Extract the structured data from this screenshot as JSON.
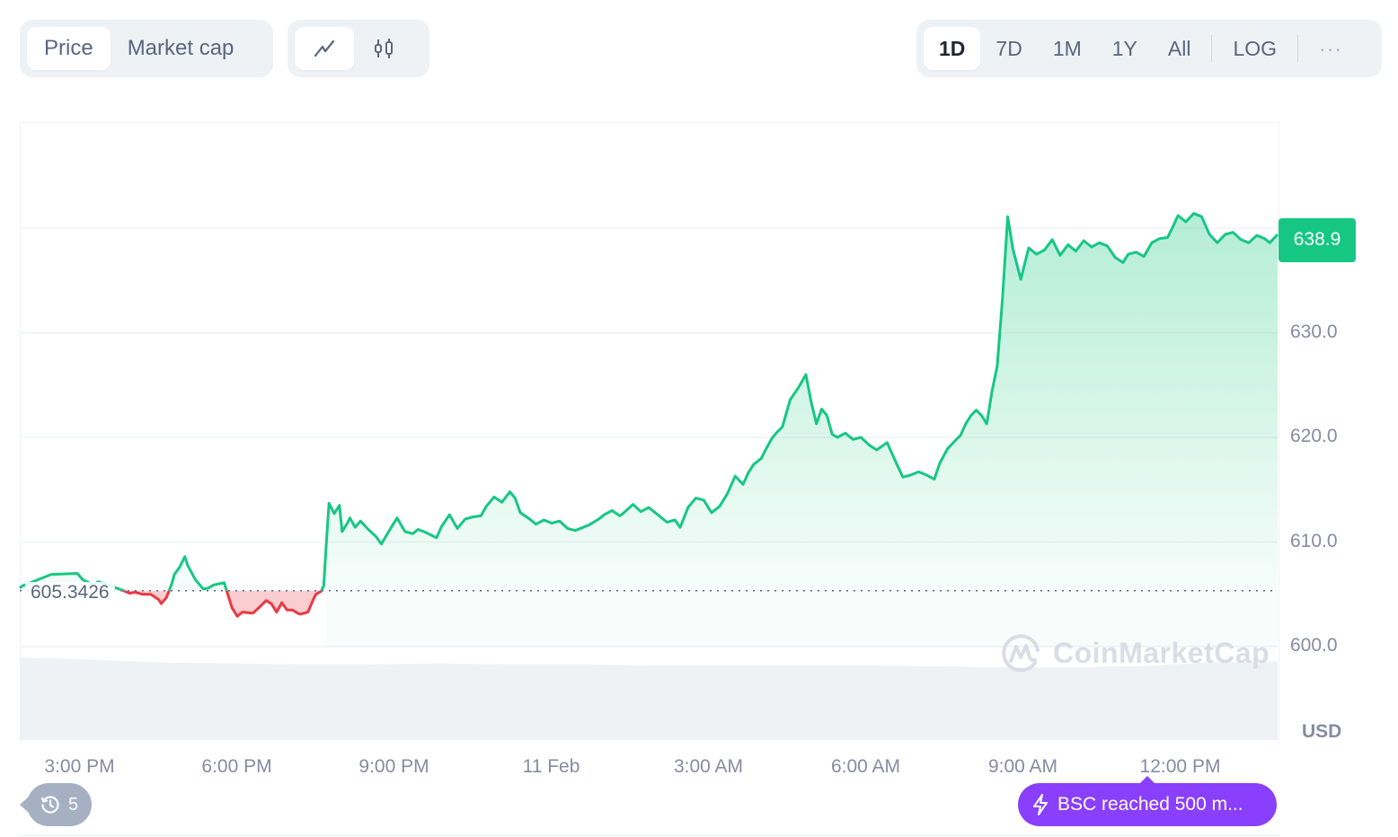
{
  "toolbar": {
    "data_type": {
      "options": [
        {
          "label": "Price",
          "active": true
        },
        {
          "label": "Market cap",
          "active": false
        }
      ]
    },
    "chart_type": {
      "options": [
        {
          "icon": "line-chart-icon",
          "active": true
        },
        {
          "icon": "candlestick-icon",
          "active": false
        }
      ]
    },
    "ranges": [
      {
        "label": "1D",
        "active": true
      },
      {
        "label": "7D",
        "active": false
      },
      {
        "label": "1M",
        "active": false
      },
      {
        "label": "1Y",
        "active": false
      },
      {
        "label": "All",
        "active": false
      }
    ],
    "log_label": "LOG",
    "more_label": "···"
  },
  "colors": {
    "up": "#16c784",
    "down": "#ea3943",
    "event": "#8a3ffc",
    "history_badge": "#a6b0c3"
  },
  "current_price_label": "638.9",
  "baseline_label": "605.3426",
  "currency_label": "USD",
  "watermark": "CoinMarketCap",
  "history_badge": {
    "icon": "history-icon",
    "count": "5"
  },
  "event_badge": {
    "icon": "lightning-icon",
    "text": "BSC reached 500 m..."
  },
  "chart_data": {
    "type": "area",
    "title": "",
    "xlabel": "",
    "ylabel": "USD",
    "baseline": 605.3426,
    "ylim": [
      596.5,
      646
    ],
    "x_tick_labels": [
      "3:00 PM",
      "6:00 PM",
      "9:00 PM",
      "11 Feb",
      "3:00 AM",
      "6:00 AM",
      "9:00 AM",
      "12:00 PM"
    ],
    "x_tick_hours": [
      1.14,
      4.14,
      7.14,
      10.14,
      13.14,
      16.14,
      19.14,
      22.14
    ],
    "y_tick_labels": [
      "600.0",
      "610.0",
      "620.0",
      "630.0"
    ],
    "y_ticks": [
      600,
      610,
      620,
      630
    ],
    "grid": true,
    "x_hours_span": 24,
    "series": [
      {
        "name": "Price",
        "x_hours": [
          0,
          0.05,
          0.6,
          1.1,
          1.2,
          1.4,
          1.5,
          1.9,
          2.1,
          2.2,
          2.35,
          2.5,
          2.65,
          2.7,
          2.8,
          2.9,
          2.95,
          3.05,
          3.15,
          3.2,
          3.35,
          3.5,
          3.6,
          3.7,
          3.8,
          3.9,
          4.05,
          4.15,
          4.25,
          4.45,
          4.6,
          4.7,
          4.8,
          4.9,
          5.0,
          5.1,
          5.2,
          5.3,
          5.35,
          5.5,
          5.6,
          5.65,
          5.75,
          5.8,
          5.85,
          5.9,
          6.0,
          6.1,
          6.15,
          6.25,
          6.3,
          6.4,
          6.5,
          6.65,
          6.8,
          6.9,
          7.05,
          7.2,
          7.35,
          7.5,
          7.6,
          7.75,
          7.95,
          8.05,
          8.2,
          8.35,
          8.5,
          8.65,
          8.8,
          8.9,
          9.05,
          9.2,
          9.35,
          9.45,
          9.55,
          9.7,
          9.85,
          10.0,
          10.15,
          10.3,
          10.45,
          10.6,
          10.75,
          10.85,
          10.95,
          11.05,
          11.15,
          11.3,
          11.45,
          11.55,
          11.7,
          11.85,
          12.0,
          12.1,
          12.2,
          12.35,
          12.5,
          12.6,
          12.75,
          12.9,
          13.05,
          13.2,
          13.35,
          13.5,
          13.65,
          13.8,
          13.9,
          14.0,
          14.15,
          14.25,
          14.35,
          14.45,
          14.55,
          14.7,
          14.85,
          15.0,
          15.1,
          15.2,
          15.3,
          15.4,
          15.5,
          15.6,
          15.75,
          15.9,
          16.05,
          16.2,
          16.35,
          16.55,
          16.7,
          16.85,
          17.0,
          17.15,
          17.3,
          17.45,
          17.55,
          17.7,
          17.85,
          17.95,
          18.05,
          18.15,
          18.25,
          18.35,
          18.45,
          18.55,
          18.65,
          18.75,
          18.85,
          18.95,
          19.1,
          19.25,
          19.4,
          19.55,
          19.7,
          19.85,
          20.0,
          20.15,
          20.3,
          20.45,
          20.6,
          20.75,
          20.9,
          21.05,
          21.15,
          21.3,
          21.45,
          21.6,
          21.75,
          21.9,
          22.0,
          22.1,
          22.25,
          22.4,
          22.55,
          22.7,
          22.85,
          23.0,
          23.15,
          23.3,
          23.45,
          23.6,
          23.75,
          23.85,
          24.0
        ],
        "values": [
          605.6,
          605.8,
          606.9,
          607.0,
          606.4,
          605.9,
          606.2,
          605.5,
          605.1,
          605.2,
          605.0,
          605.0,
          604.5,
          604.1,
          604.7,
          606.0,
          606.9,
          607.6,
          608.6,
          607.8,
          606.4,
          605.5,
          605.6,
          605.9,
          606.0,
          606.1,
          603.7,
          602.9,
          603.3,
          603.2,
          603.9,
          604.4,
          604.1,
          603.3,
          604.2,
          603.5,
          603.5,
          603.2,
          603.1,
          603.3,
          604.5,
          605.0,
          605.3,
          605.8,
          610.0,
          613.7,
          612.7,
          613.5,
          611.0,
          611.8,
          612.3,
          611.4,
          612.0,
          611.2,
          610.5,
          609.8,
          611.1,
          612.3,
          611.0,
          610.8,
          611.2,
          610.9,
          610.4,
          611.5,
          612.6,
          611.3,
          612.2,
          612.4,
          612.5,
          613.4,
          614.3,
          613.8,
          614.8,
          614.2,
          612.8,
          612.3,
          611.7,
          612.1,
          611.8,
          612.0,
          611.3,
          611.1,
          611.4,
          611.6,
          611.9,
          612.2,
          612.6,
          613.0,
          612.5,
          612.9,
          613.6,
          612.9,
          613.3,
          612.9,
          612.5,
          611.9,
          612.1,
          611.4,
          613.3,
          614.2,
          614.0,
          612.8,
          613.4,
          614.6,
          616.3,
          615.5,
          616.6,
          617.4,
          618.0,
          619.0,
          619.9,
          620.5,
          621.0,
          623.6,
          624.7,
          626.0,
          623.4,
          621.3,
          622.7,
          622.1,
          620.3,
          620.0,
          620.4,
          619.8,
          620.0,
          619.3,
          618.8,
          619.5,
          617.8,
          616.2,
          616.4,
          616.7,
          616.4,
          616.0,
          617.5,
          618.9,
          619.7,
          620.2,
          621.3,
          622.1,
          622.6,
          622.1,
          621.3,
          624.4,
          626.8,
          633.3,
          641.1,
          638.0,
          635.1,
          638.1,
          637.5,
          637.9,
          638.9,
          637.4,
          638.4,
          637.8,
          638.8,
          638.2,
          638.6,
          638.3,
          637.2,
          636.7,
          637.5,
          637.7,
          637.3,
          638.6,
          639.0,
          639.1,
          640.1,
          641.2,
          640.6,
          641.4,
          641.1,
          639.4,
          638.6,
          639.4,
          639.6,
          638.9,
          638.6,
          639.3,
          639.0,
          638.6,
          639.4,
          638.9
        ]
      }
    ],
    "volume": {
      "note": "relative volume band, unlabeled",
      "relative_values": [
        0.95,
        0.93,
        0.9,
        0.89,
        0.88,
        0.88,
        0.89,
        0.88,
        0.88,
        0.87,
        0.87,
        0.87,
        0.87,
        0.86,
        0.85,
        0.85,
        0.86,
        0.9,
        0.91
      ]
    }
  }
}
